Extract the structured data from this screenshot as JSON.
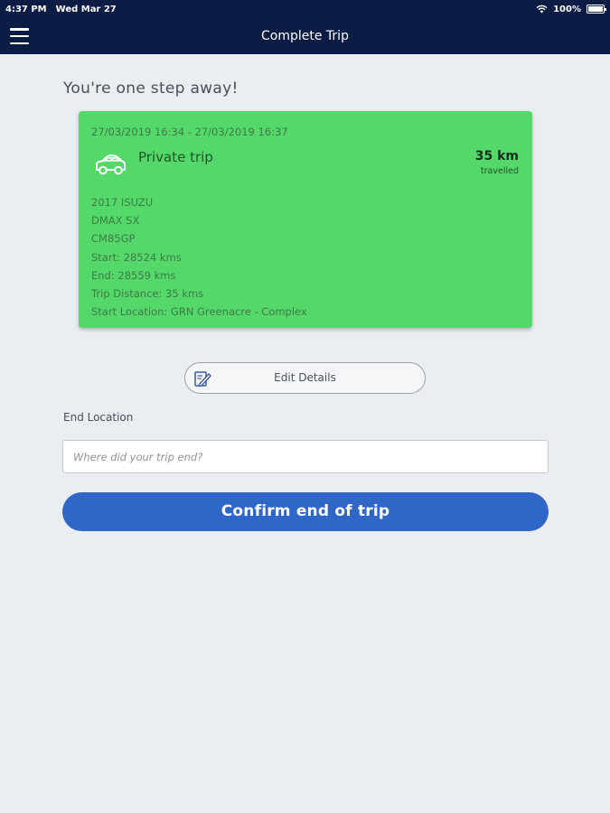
{
  "status_bar": {
    "time": "4:37 PM",
    "date": "Wed Mar 27",
    "battery": "100%",
    "battery_level": 1.0,
    "icons": [
      "wifi-icon",
      "battery-icon"
    ]
  },
  "nav": {
    "title": "Complete Trip",
    "menu_icon": "menu-icon"
  },
  "headline": "You're one step away!",
  "trip_card": {
    "dates": "27/03/2019 16:34 - 27/03/2019 16:37",
    "type": "Private trip",
    "icon": "car-icon",
    "distance": "35 km",
    "distance_label": "travelled",
    "details": [
      "2017 ISUZU",
      "DMAX SX",
      "CM85GP",
      "Start: 28524 kms",
      "End: 28559 kms",
      "Trip Distance: 35 kms",
      "Start Location: GRN Greenacre - Complex"
    ],
    "color": "#55d86a"
  },
  "edit_button": {
    "label": "Edit Details",
    "icon": "edit-document-icon"
  },
  "end_location": {
    "label": "End Location",
    "placeholder": "Where did your trip end?",
    "value": ""
  },
  "confirm_button": {
    "label": "Confirm end of trip",
    "color": "#2f66c7"
  },
  "colors": {
    "nav_background": "#0b1c44",
    "page_background": "#eaeef3"
  }
}
